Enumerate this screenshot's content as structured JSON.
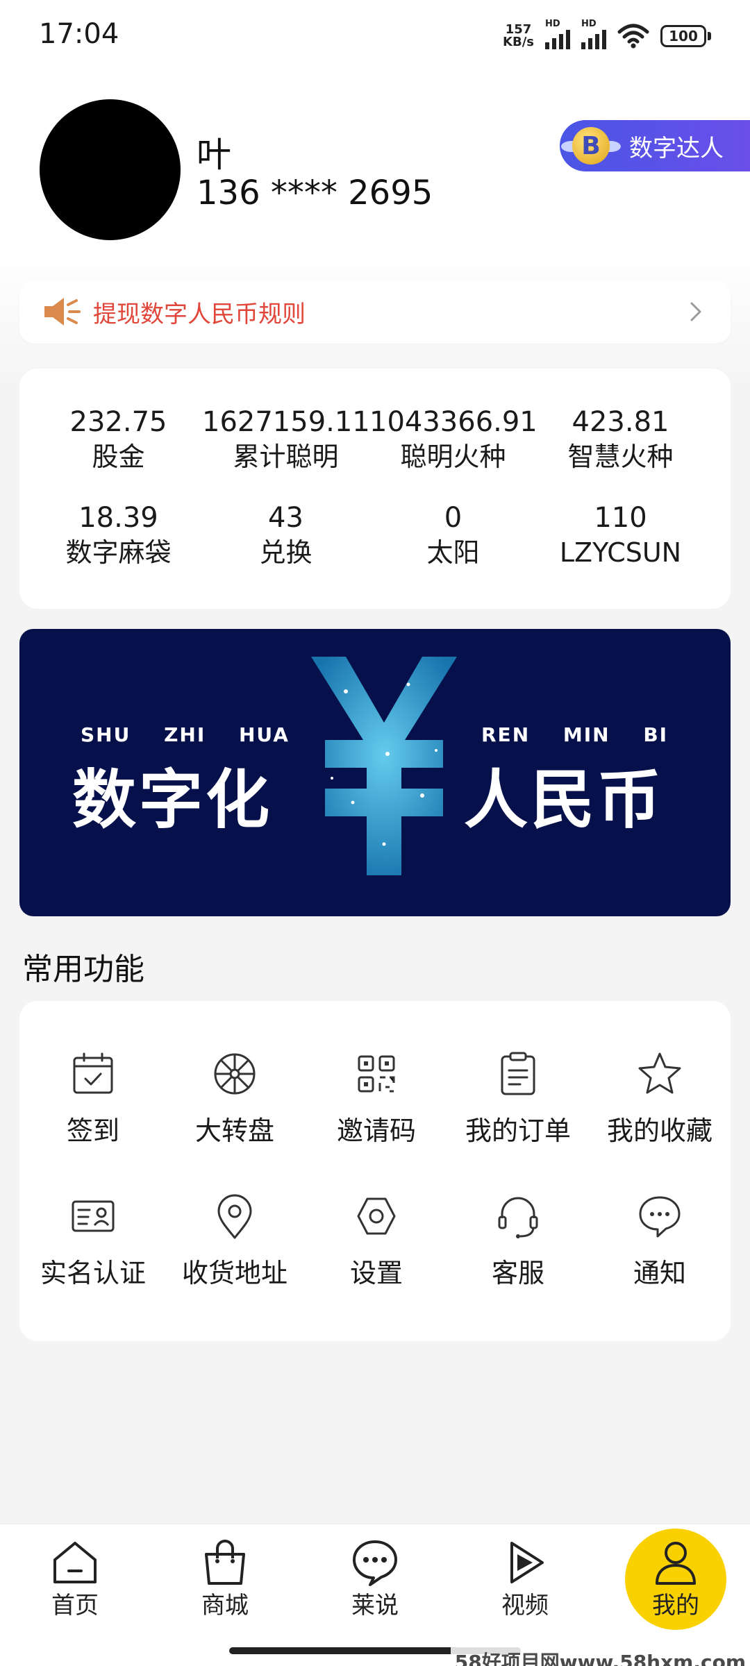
{
  "status_bar": {
    "time": "17:04",
    "net_speed_value": "157",
    "net_speed_unit": "KB/s",
    "signal_label_1": "HD",
    "signal_label_2": "HD",
    "battery": "100"
  },
  "profile": {
    "name": "叶",
    "phone": "136 **** 2695",
    "badge_label": "数字达人",
    "badge_emblem_letter": "B"
  },
  "notice": {
    "text": "提现数字人民币规则",
    "icon": "speaker-icon"
  },
  "stats": [
    {
      "value": "232.75",
      "label": "股金"
    },
    {
      "value": "1627159.11",
      "label": "累计聪明"
    },
    {
      "value": "1043366.91",
      "label": "聪明火种"
    },
    {
      "value": "423.81",
      "label": "智慧火种"
    },
    {
      "value": "18.39",
      "label": "数字麻袋"
    },
    {
      "value": "43",
      "label": "兑换"
    },
    {
      "value": "0",
      "label": "太阳"
    },
    {
      "value": "110",
      "label": "LZYCSUN"
    }
  ],
  "banner": {
    "left_pinyin": "SHU ZHI HUA",
    "left_title": "数字化",
    "right_pinyin": "REN MIN BI",
    "right_title": "人民币",
    "colors": {
      "background": "#06114b",
      "glow": "#2fb8e8"
    }
  },
  "functions": {
    "title": "常用功能",
    "items": [
      {
        "label": "签到",
        "icon": "calendar-check-icon"
      },
      {
        "label": "大转盘",
        "icon": "wheel-icon"
      },
      {
        "label": "邀请码",
        "icon": "qr-code-icon"
      },
      {
        "label": "我的订单",
        "icon": "clipboard-icon"
      },
      {
        "label": "我的收藏",
        "icon": "star-icon"
      },
      {
        "label": "实名认证",
        "icon": "id-card-icon"
      },
      {
        "label": "收货地址",
        "icon": "location-pin-icon"
      },
      {
        "label": "设置",
        "icon": "hexagon-settings-icon"
      },
      {
        "label": "客服",
        "icon": "headset-icon"
      },
      {
        "label": "通知",
        "icon": "chat-bubble-icon"
      }
    ]
  },
  "bottom_nav": {
    "active_color": "#fad100",
    "items": [
      {
        "label": "首页",
        "icon": "home-icon"
      },
      {
        "label": "商城",
        "icon": "shopping-bag-icon"
      },
      {
        "label": "莱说",
        "icon": "chat-icon"
      },
      {
        "label": "视频",
        "icon": "play-icon"
      },
      {
        "label": "我的",
        "icon": "user-icon",
        "active": true
      }
    ]
  },
  "watermark": "58好项目网www.58hxm.com"
}
